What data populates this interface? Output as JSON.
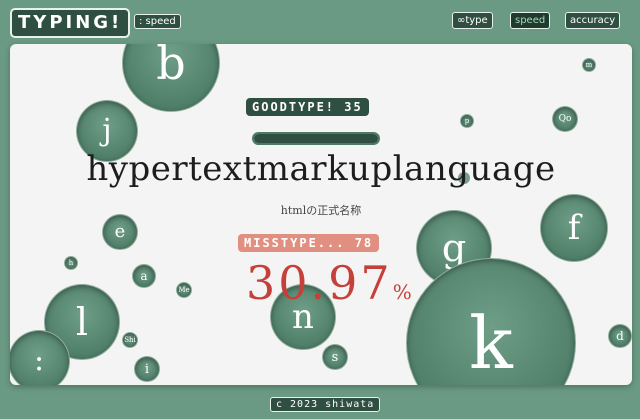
{
  "header": {
    "title": "TYPING!",
    "subtitle": ": speed",
    "nav": {
      "type": "∞type",
      "speed": "speed",
      "accuracy": "accuracy"
    }
  },
  "game": {
    "combo_label": "GOODTYPE! 35",
    "progress": 1.0,
    "word": "hypertextmarkuplanguage",
    "hint": "htmlの正式名称",
    "misstype_label": "MISSTYPE... 78",
    "accuracy_value": "30.97",
    "accuracy_unit": "%",
    "letters": [
      "b",
      "j",
      "e",
      "a",
      "l",
      ":",
      "n",
      "s",
      "i",
      "g",
      "f",
      "k",
      "d",
      "Me",
      "Shi",
      "p",
      "m",
      "Qo",
      "h"
    ]
  },
  "footer": {
    "label": "c 2023 shiwata"
  },
  "colors": {
    "background": "#6a9a83",
    "panel": "#f3f4f3",
    "accent_dark": "#2f4f42",
    "accuracy_red": "#c5403a",
    "miss_pink": "#e08f80"
  }
}
